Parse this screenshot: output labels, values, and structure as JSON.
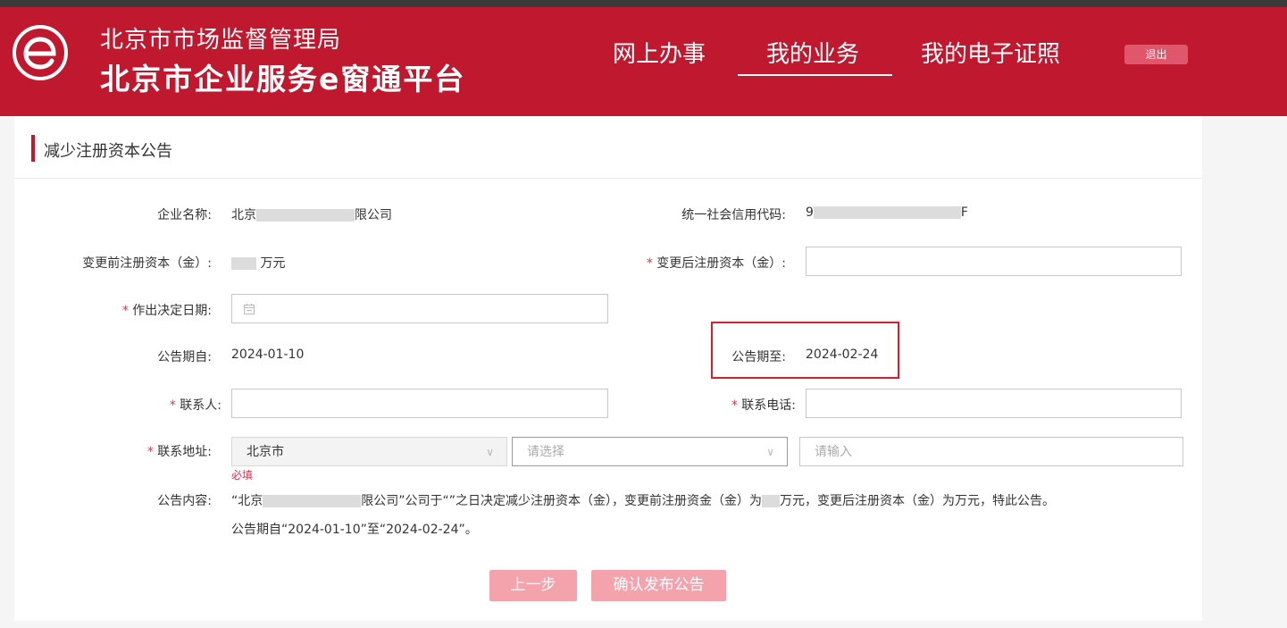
{
  "header": {
    "org_name": "北京市市场监督管理局",
    "platform_name": "北京市企业服务e窗通平台",
    "nav": [
      "网上办事",
      "我的业务",
      "我的电子证照"
    ],
    "active_nav": "我的业务",
    "logout": "退出"
  },
  "colors": {
    "brand": "#c0192f",
    "required": "#e0304a",
    "button_disabled": "#f4a3ad"
  },
  "section": {
    "title": "减少注册资本公告"
  },
  "form": {
    "company_name_label": "企业名称:",
    "company_name_prefix": "北京",
    "company_name_suffix": "限公司",
    "credit_code_label": "统一社会信用代码:",
    "credit_code_prefix": "9",
    "credit_code_suffix": "F",
    "capital_before_label": "变更前注册资本（金）:",
    "capital_before_unit": "万元",
    "capital_after_label": "变更后注册资本（金）:",
    "capital_after_value": "",
    "decision_date_label": "作出决定日期:",
    "decision_date_value": "",
    "notice_from_label": "公告期自:",
    "notice_from_value": "2024-01-10",
    "notice_to_label": "公告期至:",
    "notice_to_value": "2024-02-24",
    "contact_label": "联系人:",
    "contact_value": "",
    "phone_label": "联系电话:",
    "phone_value": "",
    "address_label": "联系地址:",
    "address_city": "北京市",
    "address_district_placeholder": "请选择",
    "address_detail_placeholder": "请输入",
    "required_hint": "必填",
    "content_label": "公告内容:",
    "content_line1_a": "“北京",
    "content_line1_b": "限公司”公司于“”之日决定减少注册资本（金），变更前注册资金（金）为",
    "content_line1_c": "万元，变更后注册资本（金）为万元，特此公告。",
    "content_line2": "公告期自“2024-01-10”至“2024-02-24”。"
  },
  "buttons": {
    "prev": "上一步",
    "publish": "确认发布公告"
  }
}
